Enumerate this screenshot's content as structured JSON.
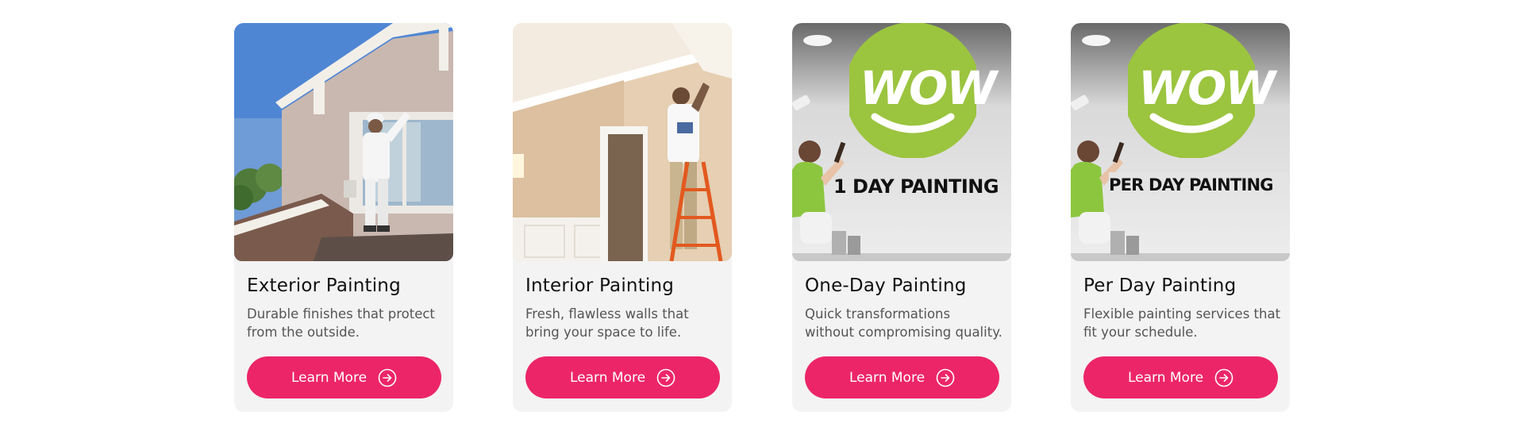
{
  "colors": {
    "accent": "#ec2569",
    "card_bg": "#f3f3f3",
    "wow_green": "#9bc43f"
  },
  "cards": [
    {
      "title": "Exterior Painting",
      "description": "Durable finishes that protect from the outside.",
      "button_label": "Learn More",
      "image_subject": "painter on ladder painting exterior trim of house"
    },
    {
      "title": "Interior Painting",
      "description": "Fresh, flawless walls that bring your space to life.",
      "button_label": "Learn More",
      "image_subject": "painter on orange ladder painting interior ceiling trim"
    },
    {
      "title": "One-Day Painting",
      "description": "Quick transformations without compromising quality.",
      "button_label": "Learn More",
      "image_subject": "painter in green shirt next to WOW logo",
      "logo_text": "WOW",
      "banner_text": "1 DAY PAINTING"
    },
    {
      "title": "Per Day Painting",
      "description": "Flexible painting services that fit your schedule.",
      "button_label": "Learn More",
      "image_subject": "painter in green shirt next to WOW logo",
      "logo_text": "WOW",
      "banner_text": "PER DAY PAINTING"
    }
  ],
  "icons": {
    "button_icon": "arrow-right-circle-icon"
  }
}
